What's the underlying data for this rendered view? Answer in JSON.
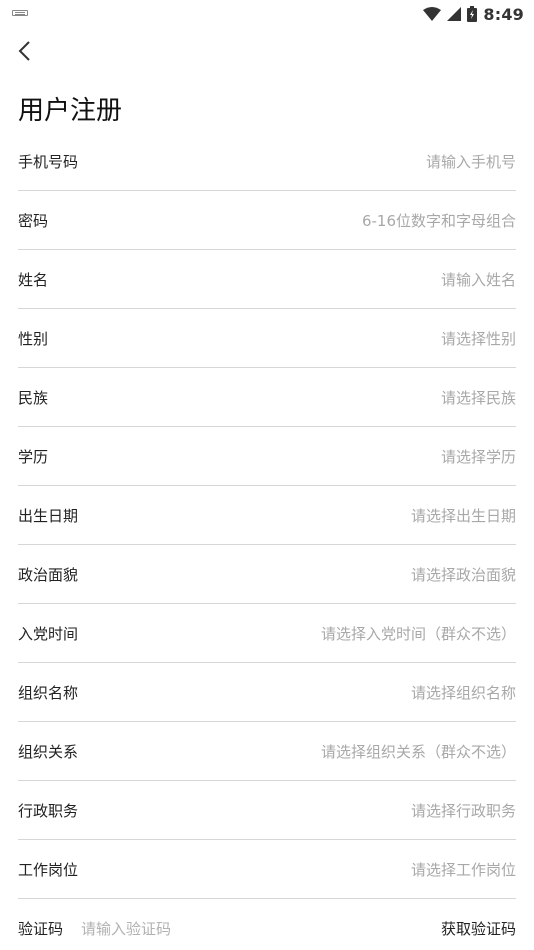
{
  "status_bar": {
    "time": "8:49",
    "icons": [
      "keyboard-icon",
      "wifi-icon",
      "cellular-signal-icon",
      "battery-icon"
    ]
  },
  "header": {
    "back_icon": "chevron-left-icon",
    "title": "用户注册"
  },
  "form": {
    "fields": [
      {
        "label": "手机号码",
        "placeholder": "请输入手机号"
      },
      {
        "label": "密码",
        "placeholder": "6-16位数字和字母组合"
      },
      {
        "label": "姓名",
        "placeholder": "请输入姓名"
      },
      {
        "label": "性别",
        "placeholder": "请选择性别"
      },
      {
        "label": "民族",
        "placeholder": "请选择民族"
      },
      {
        "label": "学历",
        "placeholder": "请选择学历"
      },
      {
        "label": "出生日期",
        "placeholder": "请选择出生日期"
      },
      {
        "label": "政治面貌",
        "placeholder": "请选择政治面貌"
      },
      {
        "label": "入党时间",
        "placeholder": "请选择入党时间（群众不选）"
      },
      {
        "label": "组织名称",
        "placeholder": "请选择组织名称"
      },
      {
        "label": "组织关系",
        "placeholder": "请选择组织关系（群众不选）"
      },
      {
        "label": "行政职务",
        "placeholder": "请选择行政职务"
      },
      {
        "label": "工作岗位",
        "placeholder": "请选择工作岗位"
      }
    ],
    "verification": {
      "label": "验证码",
      "placeholder": "请输入验证码",
      "get_code_label": "获取验证码"
    }
  }
}
